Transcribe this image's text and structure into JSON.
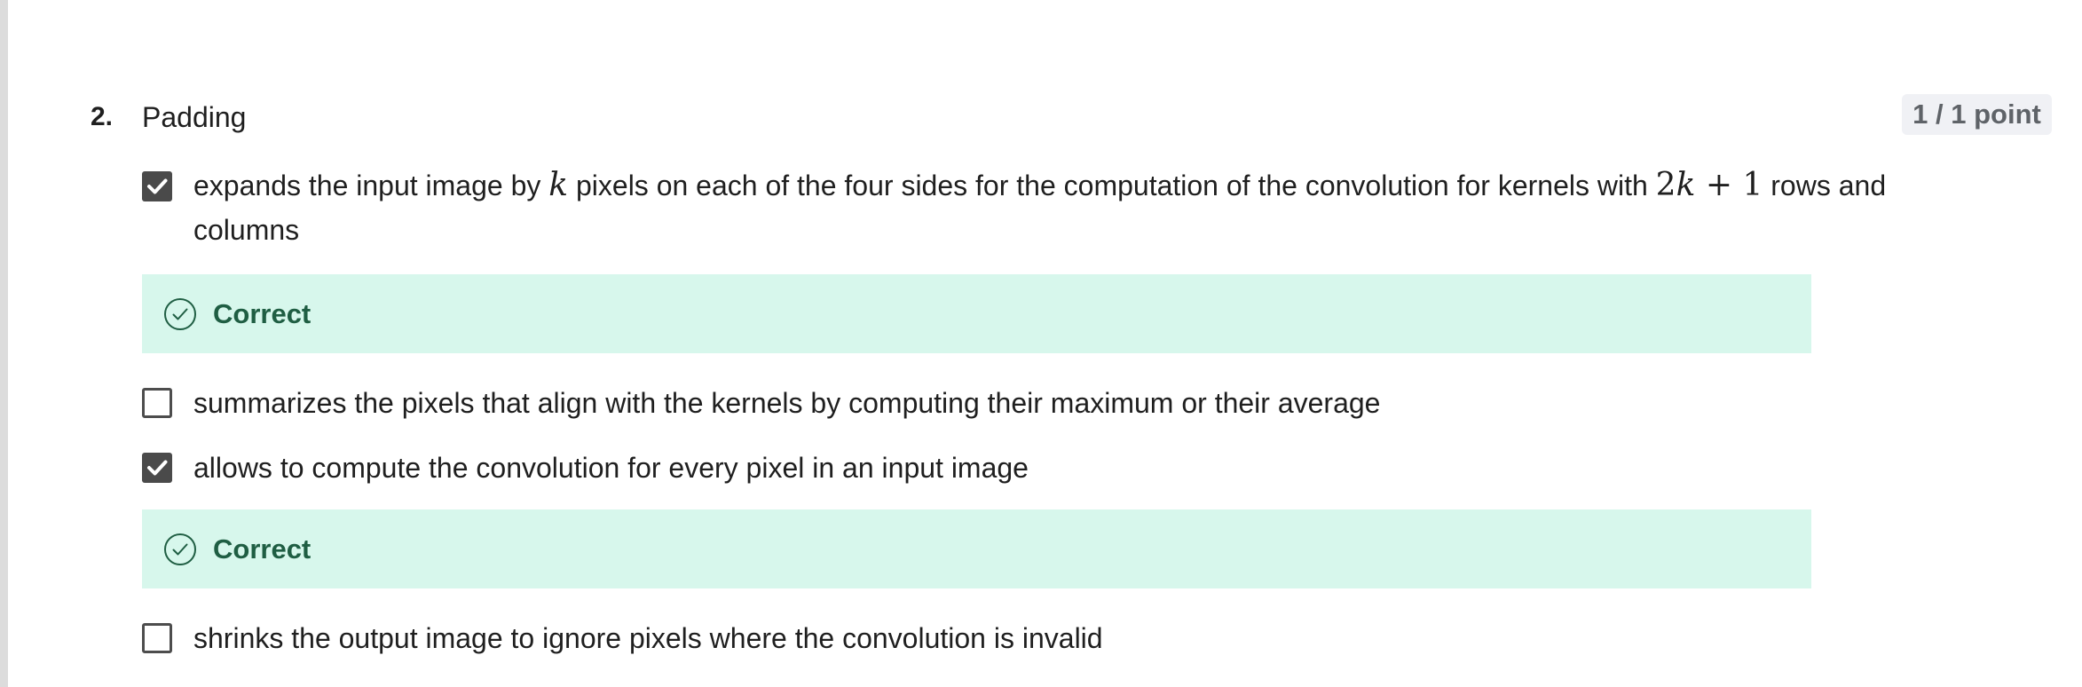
{
  "question": {
    "number": "2.",
    "title": "Padding",
    "points": "1 / 1 point"
  },
  "options": [
    {
      "text_before": "expands the input image by ",
      "math_var": "k",
      "text_middle": " pixels on each of the four sides for the computation of the convolution for kernels with ",
      "math_expr_coef": "2",
      "math_expr_var": "k",
      "math_expr_rest": " + 1",
      "text_after": " rows and columns",
      "checked": true,
      "feedback": "Correct"
    },
    {
      "text": "summarizes the pixels that align with the kernels by computing their maximum or their average",
      "checked": false
    },
    {
      "text": "allows to compute the convolution for every pixel in an input image",
      "checked": true,
      "feedback": "Correct"
    },
    {
      "text": "shrinks the output image to ignore pixels where the convolution is invalid",
      "checked": false
    }
  ],
  "icons": {
    "checkbox_checked": "checkmark-icon",
    "feedback": "check-circle-icon"
  },
  "colors": {
    "feedback_background": "#d7f7ec",
    "feedback_text": "#1f5e43",
    "checkbox_fill": "#4a4a4a",
    "points_badge_background": "#f0f1f5"
  }
}
